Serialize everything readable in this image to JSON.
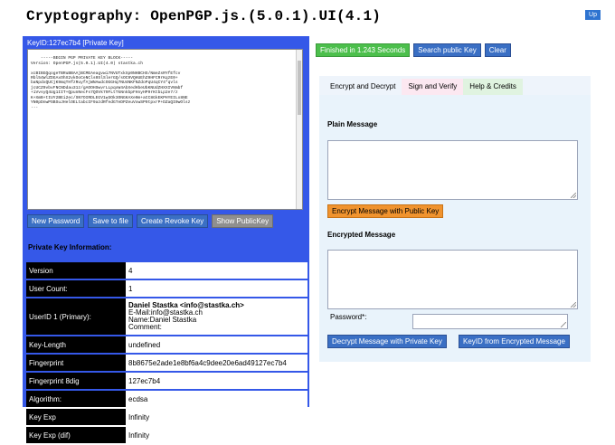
{
  "title": "Cryptography: OpenPGP.js.(5.0.1).UI(4.1)",
  "up_label": "Up",
  "left": {
    "keyid": "KeyID:127ec7b4 [Private Key]",
    "armor": "-----BEGIN PGP PRIVATE KEY BLOCK-----\nVersion: OpenPGP.js(5.0.1).UI(4.0) stastka.ch\n\nxcBIBGQqogeTBRuBBAAjBCMEAeagvwi7NVUTxkXp0NHBCHS/NmeZsRYfEfcv\nRbl54WlZDGAxOhX2vkOoCeNCls0SlSlerGQ/sOC9VQHUEhZ9HFCRrKqzE0+\nbaNpdxQUCjK9mqTHfzRuyfAjWNAwdcOGGHq7NU4NKFNZdoPqU4qCY4*qvls\njcUCZ9vbvFNCNDdau31z/gAOOHSwvrLLpqxW4AbXedHbeUbKNUdZHXXIVNmbf\n+iVvsyQ4Ug1IIT+QpunNecFs7QOVk79FLtTkNnkbpFHnyHP9rKtbLp2e7/z\nK+XmB+tIUY2BEi2ec/SN7OIRDLEGV1w3Ok3ONGKAXe0m+aCC8GkEKPHYEILx8NE\nYN0pDnwPSBSuJHelOELtabcIF9azdRfedGTeDPZeuVxwSP9tpxrP+DZaQI0wOlsz\n...",
    "buttons": [
      "New Password",
      "Save to file",
      "Create Revoke Key",
      "Show PublicKey"
    ],
    "info_title": "Private Key Information:",
    "info_rows": [
      {
        "label": "Version",
        "value": "4"
      },
      {
        "label": "User Count:",
        "value": "1"
      },
      {
        "label": "UserID 1 (Primary):",
        "uid": {
          "name": "Daniel Stastka <info@stastka.ch>",
          "email": "E-Mail:info@stastka.ch",
          "name_line": "Name:Daniel Stastka",
          "comment": "Comment:"
        }
      },
      {
        "label": "Key-Length",
        "value": "undefined"
      },
      {
        "label": "Fingerprint",
        "value": "8b8675e2ade1e8bf6a4c9dee20e6ad49127ec7b4"
      },
      {
        "label": "Fingerprint 8dig",
        "value": "127ec7b4"
      },
      {
        "label": "Algorithm:",
        "value": "ecdsa"
      },
      {
        "label": "Key Exp",
        "value": "Infinity"
      },
      {
        "label": "Key Exp (dif)",
        "value": "Infinity"
      }
    ]
  },
  "status": {
    "finished": "Finished in 1.243 Seconds",
    "search": "Search public Key",
    "clear": "Clear"
  },
  "tabs": [
    "Encrypt and Decrypt",
    "Sign and Verify",
    "Help & Credits"
  ],
  "encrypt": {
    "plain_label": "Plain Message",
    "encrypt_btn": "Encrypt Message with Public Key",
    "encrypted_label": "Encrypted Message",
    "password_label": "Password*:",
    "decrypt_btn": "Decrypt Message with Private Key",
    "keyid_btn": "KeyID from Encrypted Message"
  },
  "colors": {
    "panel_blue": "#3558e8",
    "button_blue": "#3a6fc4",
    "green": "#4cbf4c",
    "orange": "#f0932e"
  }
}
